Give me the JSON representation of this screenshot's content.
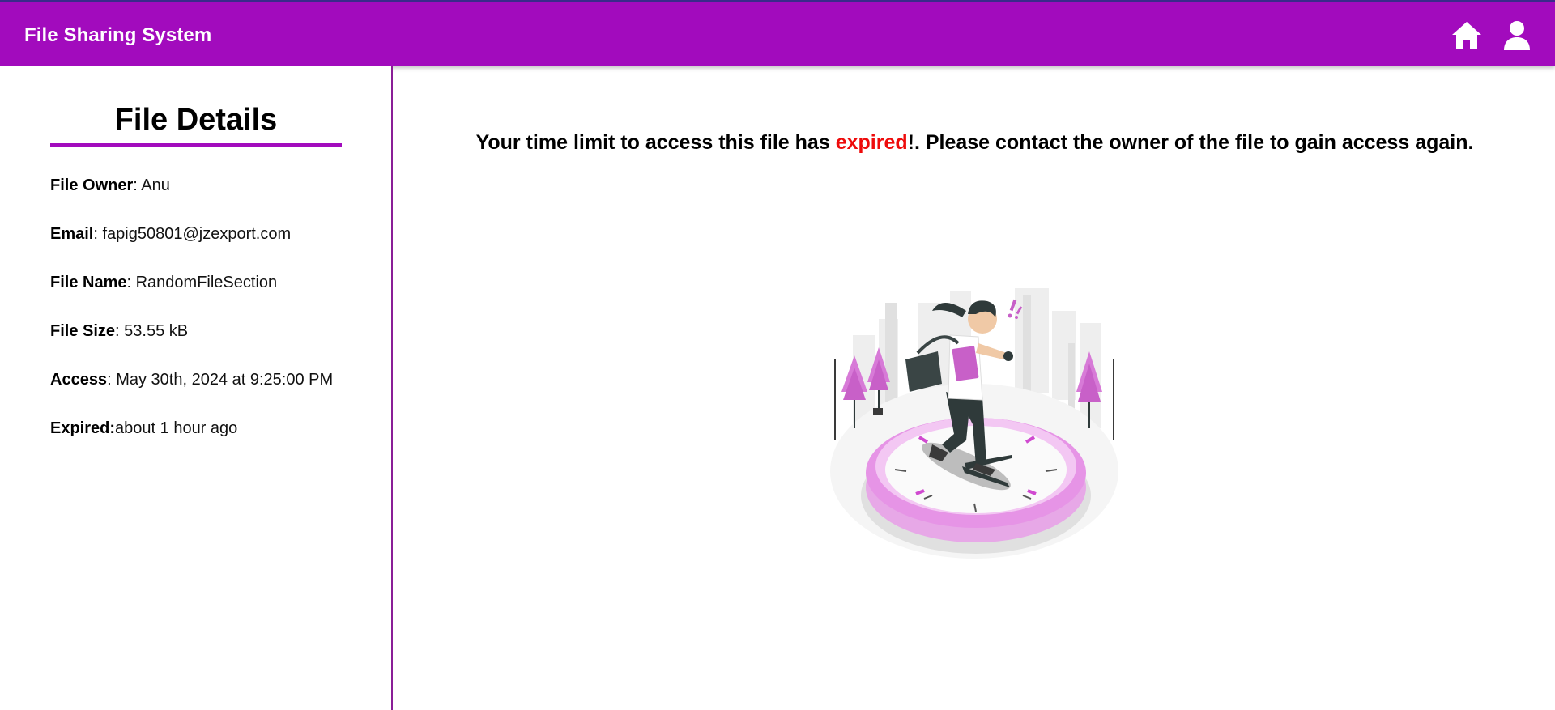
{
  "app": {
    "title": "File Sharing System",
    "accent_color": "#a20bbd",
    "nav_icons": [
      "home-icon",
      "user-icon"
    ]
  },
  "sidebar": {
    "title": "File Details",
    "details": [
      {
        "label": "File Owner",
        "sep": ": ",
        "value": "Anu"
      },
      {
        "label": "Email",
        "sep": ": ",
        "value": "fapig50801@jzexport.com"
      },
      {
        "label": "File Name",
        "sep": ": ",
        "value": "RandomFileSection"
      },
      {
        "label": "File Size",
        "sep": ": ",
        "value": "53.55 kB"
      },
      {
        "label": "Access",
        "sep": ": ",
        "value": "May 30th, 2024 at 9:25:00 PM"
      },
      {
        "label": "Expired:",
        "sep": "",
        "value": "about 1 hour ago"
      }
    ]
  },
  "main": {
    "message_before": "Your time limit to access this file has ",
    "message_highlight": "expired",
    "message_after": "!. Please contact the owner of the file to gain access again.",
    "highlight_color": "#ee0b0b",
    "illustration": "woman-running-on-clock-illustration"
  }
}
